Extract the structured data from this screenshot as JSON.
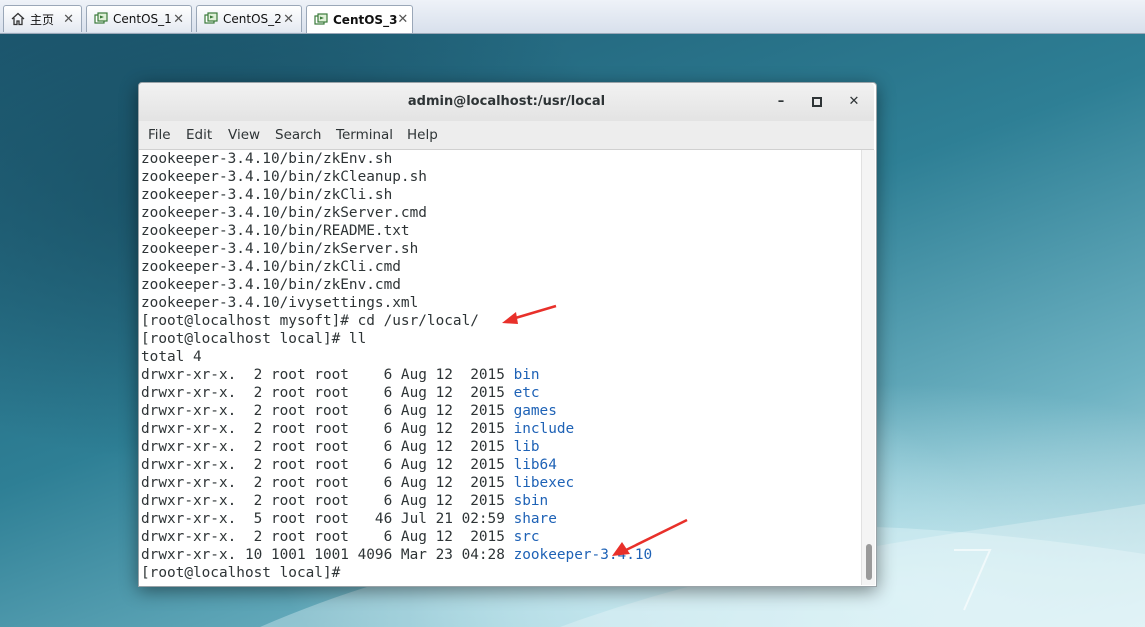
{
  "tabs": [
    {
      "label": "主页",
      "icon": "home-icon",
      "active": false
    },
    {
      "label": "CentOS_1",
      "icon": "vm-icon",
      "active": false
    },
    {
      "label": "CentOS_2",
      "icon": "vm-icon",
      "active": false
    },
    {
      "label": "CentOS_3",
      "icon": "vm-icon",
      "active": true
    }
  ],
  "tab_close": "✕",
  "desktop": {
    "version_mark": "7"
  },
  "window": {
    "title": "admin@localhost:/usr/local",
    "minimize": "–",
    "maximize": "□",
    "close": "✕"
  },
  "menu": [
    "File",
    "Edit",
    "View",
    "Search",
    "Terminal",
    "Help"
  ],
  "terminal": {
    "lines": [
      "zookeeper-3.4.10/bin/zkEnv.sh",
      "zookeeper-3.4.10/bin/zkCleanup.sh",
      "zookeeper-3.4.10/bin/zkCli.sh",
      "zookeeper-3.4.10/bin/zkServer.cmd",
      "zookeeper-3.4.10/bin/README.txt",
      "zookeeper-3.4.10/bin/zkServer.sh",
      "zookeeper-3.4.10/bin/zkCli.cmd",
      "zookeeper-3.4.10/bin/zkEnv.cmd",
      "zookeeper-3.4.10/ivysettings.xml",
      "[root@localhost mysoft]# cd /usr/local/",
      "[root@localhost local]# ll",
      "total 4"
    ],
    "listing": [
      {
        "meta": "drwxr-xr-x.  2 root root    6 Aug 12  2015 ",
        "name": "bin"
      },
      {
        "meta": "drwxr-xr-x.  2 root root    6 Aug 12  2015 ",
        "name": "etc"
      },
      {
        "meta": "drwxr-xr-x.  2 root root    6 Aug 12  2015 ",
        "name": "games"
      },
      {
        "meta": "drwxr-xr-x.  2 root root    6 Aug 12  2015 ",
        "name": "include"
      },
      {
        "meta": "drwxr-xr-x.  2 root root    6 Aug 12  2015 ",
        "name": "lib"
      },
      {
        "meta": "drwxr-xr-x.  2 root root    6 Aug 12  2015 ",
        "name": "lib64"
      },
      {
        "meta": "drwxr-xr-x.  2 root root    6 Aug 12  2015 ",
        "name": "libexec"
      },
      {
        "meta": "drwxr-xr-x.  2 root root    6 Aug 12  2015 ",
        "name": "sbin"
      },
      {
        "meta": "drwxr-xr-x.  5 root root   46 Jul 21 02:59 ",
        "name": "share"
      },
      {
        "meta": "drwxr-xr-x.  2 root root    6 Aug 12  2015 ",
        "name": "src"
      },
      {
        "meta": "drwxr-xr-x. 10 1001 1001 4096 Mar 23 04:28 ",
        "name": "zookeeper-3.4.10"
      }
    ],
    "prompt": "[root@localhost local]# "
  },
  "colors": {
    "dir_blue": "#1e62b6",
    "annotation_red": "#e8302a",
    "text": "#2e3436"
  }
}
